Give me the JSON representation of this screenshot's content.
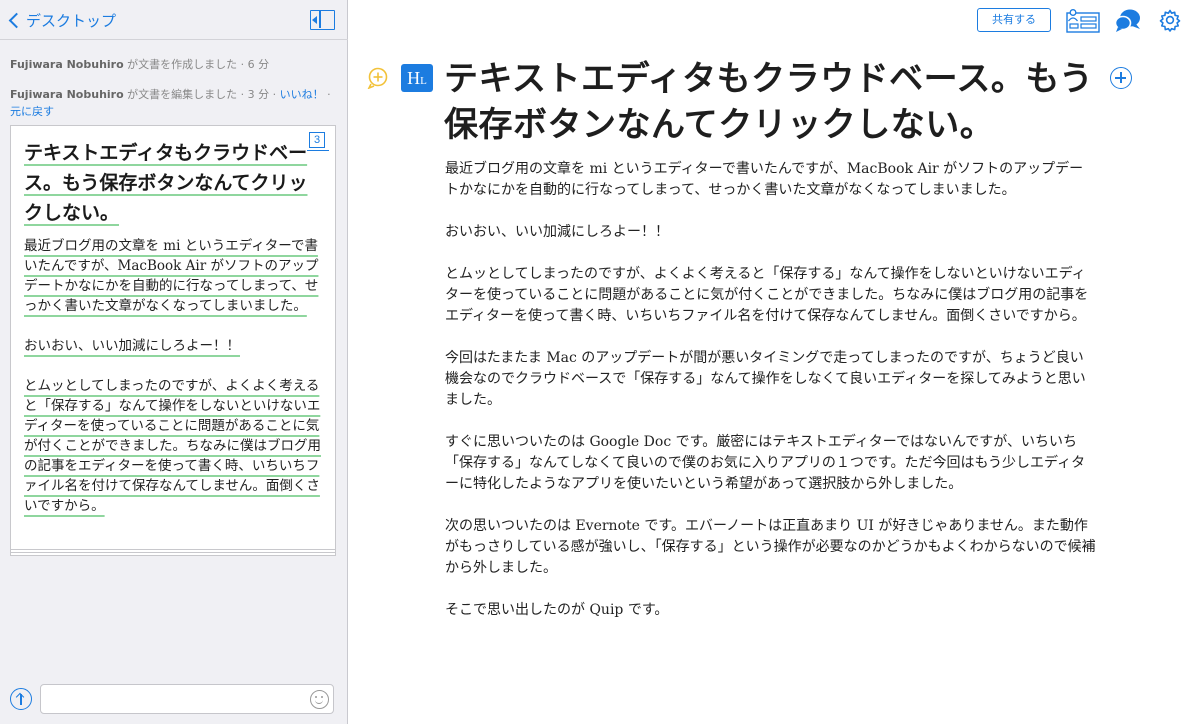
{
  "nav": {
    "back_label": "デスクトップ"
  },
  "activity": [
    {
      "user": "Fujiwara Nobuhiro",
      "action": " が文書を作成しました · 6 分"
    },
    {
      "user": "Fujiwara Nobuhiro",
      "action": " が文書を編集しました · 3 分 · ",
      "like_label": "いいね！",
      "separator": " · ",
      "revert_label": "元に戻す"
    }
  ],
  "thumbnail": {
    "version_badge": "3",
    "title": "テキストエディタもクラウドベース。もう保存ボタンなんてクリックしない。",
    "paragraphs": [
      "最近ブログ用の文章を mi というエディターで書いたんですが、MacBook Air がソフトのアップデートかなにかを自動的に行なってしまって、せっかく書いた文章がなくなってしまいました。",
      "おいおい、いい加減にしろよー！！",
      "とムッとしてしまったのですが、よくよく考えると「保存する」なんて操作をしないといけないエディターを使っていることに問題があることに気が付くことができました。ちなみに僕はブログ用の記事をエディターを使って書く時、いちいちファイル名を付けて保存なんてしません。面倒くさいですから。"
    ]
  },
  "chat": {
    "input_value": "",
    "input_placeholder": ""
  },
  "toolbar": {
    "share_label": "共有する",
    "icons": [
      "members-icon",
      "chat-bubbles-icon",
      "gear-icon"
    ],
    "accent_color": "#1c7ce0"
  },
  "doc": {
    "style_button_label": "H",
    "style_button_sub": "L",
    "title": "テキストエディタもクラウドベース。もう保存ボタンなんてクリックしない。",
    "paragraphs": [
      "最近ブログ用の文章を mi というエディターで書いたんですが、MacBook Air がソフトのアップデートかなにかを自動的に行なってしまって、せっかく書いた文章がなくなってしまいました。",
      "おいおい、いい加減にしろよー！！",
      "とムッとしてしまったのですが、よくよく考えると「保存する」なんて操作をしないといけないエディターを使っていることに問題があることに気が付くことができました。ちなみに僕はブログ用の記事をエディターを使って書く時、いちいちファイル名を付けて保存なんてしません。面倒くさいですから。",
      "今回はたまたま Mac のアップデートが間が悪いタイミングで走ってしまったのですが、ちょうど良い機会なのでクラウドベースで「保存する」なんて操作をしなくて良いエディターを探してみようと思いました。",
      "すぐに思いついたのは Google Doc です。厳密にはテキストエディターではないんですが、いちいち「保存する」なんてしなくて良いので僕のお気に入りアプリの１つです。ただ今回はもう少しエディターに特化したようなアプリを使いたいという希望があって選択肢から外しました。",
      "次の思いついたのは Evernote です。エバーノートは正直あまり UI が好きじゃありません。また動作がもっさりしている感が強いし、「保存する」という操作が必要なのかどうかもよくわからないので候補から外しました。",
      "そこで思い出したのが Quip です。"
    ]
  }
}
